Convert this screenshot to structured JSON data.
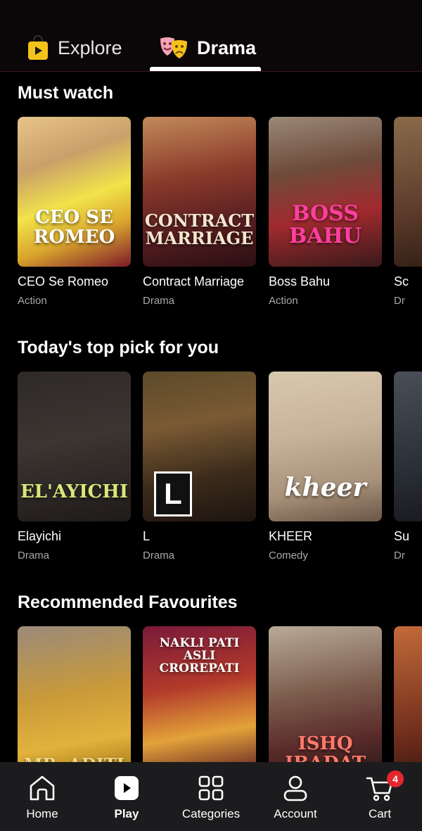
{
  "top_tabs": [
    {
      "label": "Explore",
      "icon": "shopping-bag-icon",
      "active": false
    },
    {
      "label": "Drama",
      "icon": "theater-masks-icon",
      "active": true
    }
  ],
  "sections": [
    {
      "title": "Must watch",
      "items": [
        {
          "title": "CEO Se Romeo",
          "genre": "Action",
          "poster_text": "CEO SE ROMEO"
        },
        {
          "title": "Contract Marriage",
          "genre": "Drama",
          "poster_text": "CONTRACT MARRIAGE"
        },
        {
          "title": "Boss Bahu",
          "genre": "Action",
          "poster_text": "BOSS BAHU"
        },
        {
          "title": "Sc",
          "genre": "Dr",
          "poster_text": ""
        }
      ]
    },
    {
      "title": "Today's top pick for you",
      "items": [
        {
          "title": "Elayichi",
          "genre": "Drama",
          "poster_text": "EL'AYICHI"
        },
        {
          "title": "L",
          "genre": "Drama",
          "poster_text": "L"
        },
        {
          "title": "KHEER",
          "genre": "Comedy",
          "poster_text": "kheer"
        },
        {
          "title": "Su",
          "genre": "Dr",
          "poster_text": ""
        }
      ]
    },
    {
      "title": "Recommended Favourites",
      "items": [
        {
          "title": "",
          "genre": "",
          "poster_text": "MR. ADITI"
        },
        {
          "title": "",
          "genre": "",
          "poster_text": "NAKLI PATI ASLI CROREPATI"
        },
        {
          "title": "",
          "genre": "",
          "poster_text": "ISHQ IBADAT"
        },
        {
          "title": "",
          "genre": "",
          "poster_text": ""
        }
      ]
    }
  ],
  "bottom_nav": [
    {
      "label": "Home",
      "icon": "home-icon",
      "active": false
    },
    {
      "label": "Play",
      "icon": "play-icon",
      "active": true
    },
    {
      "label": "Categories",
      "icon": "grid-icon",
      "active": false
    },
    {
      "label": "Account",
      "icon": "user-icon",
      "active": false
    },
    {
      "label": "Cart",
      "icon": "cart-icon",
      "active": false,
      "badge": "4"
    }
  ],
  "colors": {
    "background": "#000000",
    "nav_background": "#1c1c1e",
    "badge": "#e5262c",
    "subtext": "#a8a8a8"
  }
}
